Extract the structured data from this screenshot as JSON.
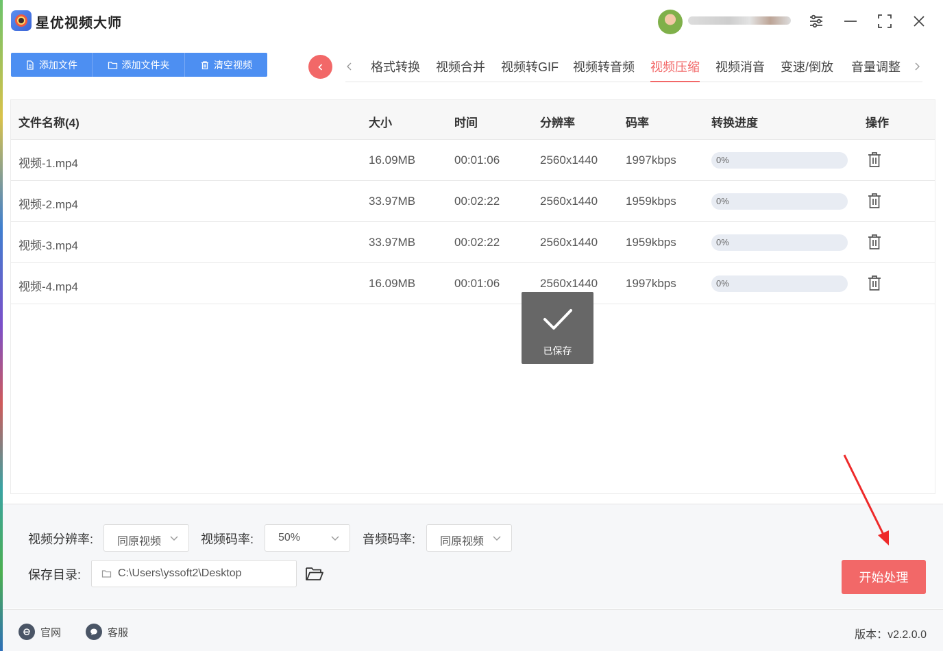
{
  "app": {
    "title": "星优视频大师"
  },
  "user": {
    "name": "JEI 2... I. J6..."
  },
  "toolbar": {
    "add_file": "添加文件",
    "add_folder": "添加文件夹",
    "clear": "清空视频"
  },
  "tabs": [
    {
      "label": "格式转换",
      "active": false
    },
    {
      "label": "视频合并",
      "active": false
    },
    {
      "label": "视频转GIF",
      "active": false
    },
    {
      "label": "视频转音频",
      "active": false
    },
    {
      "label": "视频压缩",
      "active": true
    },
    {
      "label": "视频消音",
      "active": false
    },
    {
      "label": "变速/倒放",
      "active": false
    },
    {
      "label": "音量调整",
      "active": false
    }
  ],
  "table": {
    "headers": {
      "name": "文件名称(4)",
      "size": "大小",
      "time": "时间",
      "resolution": "分辨率",
      "bitrate": "码率",
      "progress": "转换进度",
      "action": "操作"
    },
    "rows": [
      {
        "name": "视频-1.mp4",
        "size": "16.09MB",
        "time": "00:01:06",
        "resolution": "2560x1440",
        "bitrate": "1997kbps",
        "progress_text": "0%",
        "progress": 0
      },
      {
        "name": "视频-2.mp4",
        "size": "33.97MB",
        "time": "00:02:22",
        "resolution": "2560x1440",
        "bitrate": "1959kbps",
        "progress_text": "0%",
        "progress": 0
      },
      {
        "name": "视频-3.mp4",
        "size": "33.97MB",
        "time": "00:02:22",
        "resolution": "2560x1440",
        "bitrate": "1959kbps",
        "progress_text": "0%",
        "progress": 0
      },
      {
        "name": "视频-4.mp4",
        "size": "16.09MB",
        "time": "00:01:06",
        "resolution": "2560x1440",
        "bitrate": "1997kbps",
        "progress_text": "0%",
        "progress": 0
      }
    ]
  },
  "toast": {
    "text": "已保存"
  },
  "settings": {
    "video_resolution_label": "视频分辨率:",
    "video_resolution_value": "同原视频",
    "video_bitrate_label": "视频码率:",
    "video_bitrate_value": "50%",
    "audio_bitrate_label": "音频码率:",
    "audio_bitrate_value": "同原视频",
    "save_dir_label": "保存目录:",
    "save_dir_value": "C:\\Users\\yssoft2\\Desktop",
    "start_button": "开始处理"
  },
  "footer": {
    "website": "官网",
    "support": "客服",
    "version": "版本：v2.2.0.0"
  },
  "colors": {
    "accent_red": "#f26868",
    "accent_blue": "#4d8ff2"
  }
}
